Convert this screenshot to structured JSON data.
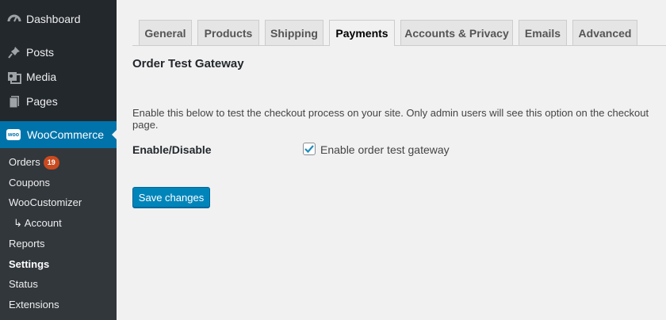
{
  "sidebar": {
    "top_items": [
      {
        "label": "Dashboard",
        "icon": "dashboard-icon"
      },
      {
        "label": "Posts",
        "icon": "pin-icon"
      },
      {
        "label": "Media",
        "icon": "media-icon"
      },
      {
        "label": "Pages",
        "icon": "pages-icon"
      }
    ],
    "woocommerce": {
      "label": "WooCommerce",
      "logo_text": "woo"
    },
    "submenu": [
      {
        "label": "Orders",
        "badge": "19"
      },
      {
        "label": "Coupons"
      },
      {
        "label": "WooCustomizer"
      },
      {
        "label": "↳ Account"
      },
      {
        "label": "Reports"
      },
      {
        "label": "Settings",
        "current": true
      },
      {
        "label": "Status"
      },
      {
        "label": "Extensions"
      }
    ]
  },
  "tabs": [
    {
      "label": "General"
    },
    {
      "label": "Products"
    },
    {
      "label": "Shipping"
    },
    {
      "label": "Payments",
      "active": true
    },
    {
      "label": "Accounts & Privacy"
    },
    {
      "label": "Emails"
    },
    {
      "label": "Advanced"
    }
  ],
  "main": {
    "title": "Order Test Gateway",
    "description": "Enable this below to test the checkout process on your site. Only admin users will see this option on the checkout page.",
    "field_label": "Enable/Disable",
    "checkbox_label": "Enable order test gateway",
    "checkbox_checked": true,
    "save_label": "Save changes"
  },
  "colors": {
    "sidebar_bg": "#23282d",
    "submenu_bg": "#32373c",
    "accent": "#0073aa",
    "button": "#0085ba",
    "badge": "#ca4a1f"
  }
}
